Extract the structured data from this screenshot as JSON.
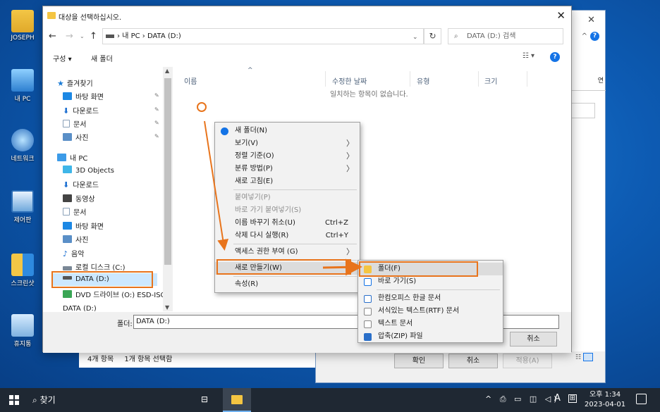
{
  "desktop": {
    "icons": [
      {
        "label": "JOSEPH"
      },
      {
        "label": "내 PC"
      },
      {
        "label": "네트워크"
      },
      {
        "label": "제어판"
      },
      {
        "label": "스크린샷"
      },
      {
        "label": "휴지통"
      }
    ]
  },
  "props_dialog": {
    "ok_label": "확인",
    "cancel_label": "취소",
    "apply_label": "적용(A)",
    "side_text": "연"
  },
  "status_bar": {
    "item_count": "4개 항목",
    "selected": "1개 항목 선택함"
  },
  "dialog": {
    "title": "대상을 선택하십시오.",
    "address_parts": [
      "내 PC",
      "DATA (D:)"
    ],
    "search_placeholder": "DATA (D:) 검색",
    "toolbar": {
      "organize": "구성 ▾",
      "new_folder": "새 폴더"
    },
    "nav_items": [
      {
        "label": "즐겨찾기",
        "icon": "star-icon",
        "color": "#1c7cd6"
      },
      {
        "label": "바탕 화면",
        "icon": "desktop-icon",
        "color": "#1c88e4"
      },
      {
        "label": "다운로드",
        "icon": "download-icon",
        "color": "#1c6fd1"
      },
      {
        "label": "문서",
        "icon": "document-icon",
        "color": "#8aa0b8"
      },
      {
        "label": "사진",
        "icon": "pictures-icon",
        "color": "#5a8fc7"
      },
      {
        "label": "내 PC",
        "icon": "pc-icon",
        "color": "#3c9be8"
      },
      {
        "label": "3D Objects",
        "icon": "cube-icon",
        "color": "#3fb6e8"
      },
      {
        "label": "다운로드",
        "icon": "download-icon",
        "color": "#1c6fd1"
      },
      {
        "label": "동영상",
        "icon": "video-icon",
        "color": "#444444"
      },
      {
        "label": "문서",
        "icon": "document-icon",
        "color": "#8aa0b8"
      },
      {
        "label": "바탕 화면",
        "icon": "desktop-icon",
        "color": "#1c88e4"
      },
      {
        "label": "사진",
        "icon": "pictures-icon",
        "color": "#5a8fc7"
      },
      {
        "label": "음악",
        "icon": "music-icon",
        "color": "#1c6fd1"
      },
      {
        "label": "로컬 디스크 (C:)",
        "icon": "drive-icon",
        "color": "#7a8896"
      },
      {
        "label": "DATA (D:)",
        "icon": "drive-icon",
        "color": "#555555"
      },
      {
        "label": "DVD 드라이브 (O:) ESD-ISO",
        "icon": "dvd-icon",
        "color": "#3aa655"
      },
      {
        "label": "DATA (D:)",
        "icon": "drive-icon",
        "color": "#555555"
      }
    ],
    "columns": [
      "이름",
      "수정한 날짜",
      "유형",
      "크기"
    ],
    "empty_message": "일치하는 항목이 없습니다.",
    "folder_label": "폴더:",
    "folder_value": "DATA (D:)",
    "cancel_label": "취소"
  },
  "context_menu": {
    "items": [
      {
        "label": "새 폴더(N)"
      },
      {
        "label": "보기(V)"
      },
      {
        "label": "정렬 기준(O)"
      },
      {
        "label": "분류 방법(P)"
      },
      {
        "label": "새로 고침(E)"
      },
      {
        "label": "붙여넣기(P)"
      },
      {
        "label": "바로 가기 붙여넣기(S)"
      },
      {
        "label": "이름 바꾸기 취소(U)",
        "shortcut": "Ctrl+Z"
      },
      {
        "label": "삭제 다시 실행(R)",
        "shortcut": "Ctrl+Y"
      },
      {
        "label": "액세스 권한 부여 (G)"
      },
      {
        "label": "새로 만들기(W)"
      },
      {
        "label": "속성(R)"
      }
    ]
  },
  "submenu": {
    "items": [
      {
        "label": "폴더(F)"
      },
      {
        "label": "바로 가기(S)"
      },
      {
        "label": "한컴오피스 한글 문서"
      },
      {
        "label": "서식있는 텍스트(RTF) 문서"
      },
      {
        "label": "텍스트 문서"
      },
      {
        "label": "압축(ZIP) 파일"
      }
    ]
  },
  "taskbar": {
    "search_label": "찾기",
    "ime": "A",
    "time": "오후 1:34",
    "date": "2023-04-01"
  },
  "colors": {
    "annotation": "#e8741c",
    "accent": "#1473e6"
  }
}
